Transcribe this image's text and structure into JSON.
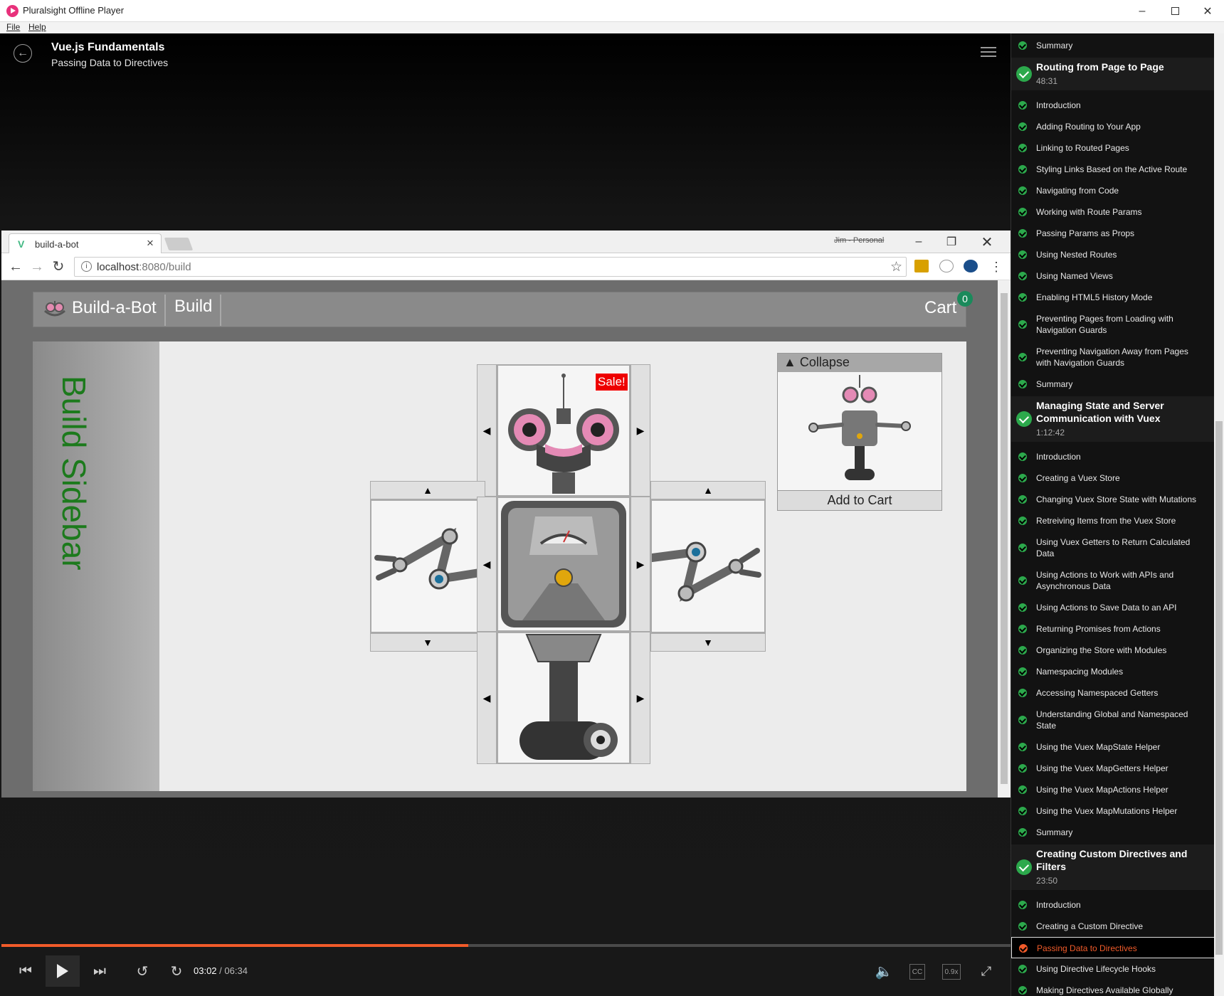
{
  "window": {
    "title": "Pluralsight Offline Player"
  },
  "menu": [
    "File",
    "Help"
  ],
  "header": {
    "course": "Vue.js Fundamentals",
    "clip": "Passing Data to Directives"
  },
  "browser": {
    "tab_title": "build-a-bot",
    "profile": "Jim - Personal",
    "url_host": "localhost",
    "url_path": ":8080/build"
  },
  "app": {
    "brand": "Build-a-Bot",
    "nav_build": "Build",
    "cart_label": "Cart",
    "cart_count": "0",
    "sidebar_text": "Build Sidebar",
    "sale_label": "Sale!",
    "collapse_label": "▲ Collapse",
    "add_to_cart": "Add to Cart"
  },
  "player": {
    "current_time": "03:02",
    "separator": "/",
    "total_time": "06:34",
    "progress_fraction": 0.4626,
    "cc_label": "CC",
    "speed_label": "0.9x",
    "accent": "#f15b2a"
  },
  "toc": [
    {
      "type": "clip",
      "label": "Summary"
    },
    {
      "type": "module",
      "label": "Routing from Page to Page",
      "duration": "48:31"
    },
    {
      "type": "clip",
      "label": "Introduction"
    },
    {
      "type": "clip",
      "label": "Adding Routing to Your App"
    },
    {
      "type": "clip",
      "label": "Linking to Routed Pages"
    },
    {
      "type": "clip",
      "label": "Styling Links Based on the Active Route"
    },
    {
      "type": "clip",
      "label": "Navigating from Code"
    },
    {
      "type": "clip",
      "label": "Working with Route Params"
    },
    {
      "type": "clip",
      "label": "Passing Params as Props"
    },
    {
      "type": "clip",
      "label": "Using Nested Routes"
    },
    {
      "type": "clip",
      "label": "Using Named Views"
    },
    {
      "type": "clip",
      "label": "Enabling HTML5 History Mode"
    },
    {
      "type": "clip",
      "label": "Preventing Pages from Loading with Navigation Guards"
    },
    {
      "type": "clip",
      "label": "Preventing Navigation Away from Pages with Navigation Guards"
    },
    {
      "type": "clip",
      "label": "Summary"
    },
    {
      "type": "module",
      "label": "Managing State and Server Communication with Vuex",
      "duration": "1:12:42"
    },
    {
      "type": "clip",
      "label": "Introduction"
    },
    {
      "type": "clip",
      "label": "Creating a Vuex Store"
    },
    {
      "type": "clip",
      "label": "Changing Vuex Store State with Mutations"
    },
    {
      "type": "clip",
      "label": "Retreiving Items from the Vuex Store"
    },
    {
      "type": "clip",
      "label": "Using Vuex Getters to Return Calculated Data"
    },
    {
      "type": "clip",
      "label": "Using Actions to Work with APIs and Asynchronous Data"
    },
    {
      "type": "clip",
      "label": "Using Actions to Save Data to an API"
    },
    {
      "type": "clip",
      "label": "Returning Promises from Actions"
    },
    {
      "type": "clip",
      "label": "Organizing the Store with Modules"
    },
    {
      "type": "clip",
      "label": "Namespacing Modules"
    },
    {
      "type": "clip",
      "label": "Accessing Namespaced Getters"
    },
    {
      "type": "clip",
      "label": "Understanding Global and Namespaced State"
    },
    {
      "type": "clip",
      "label": "Using the Vuex MapState Helper"
    },
    {
      "type": "clip",
      "label": "Using the Vuex MapGetters Helper"
    },
    {
      "type": "clip",
      "label": "Using the Vuex MapActions Helper"
    },
    {
      "type": "clip",
      "label": "Using the Vuex MapMutations Helper"
    },
    {
      "type": "clip",
      "label": "Summary"
    },
    {
      "type": "module",
      "label": "Creating Custom Directives and Filters",
      "duration": "23:50"
    },
    {
      "type": "clip",
      "label": "Introduction"
    },
    {
      "type": "clip",
      "label": "Creating a Custom Directive"
    },
    {
      "type": "clip",
      "label": "Passing Data to Directives",
      "current": true
    },
    {
      "type": "clip",
      "label": "Using Directive Lifecycle Hooks"
    },
    {
      "type": "clip",
      "label": "Making Directives Available Globally"
    }
  ]
}
